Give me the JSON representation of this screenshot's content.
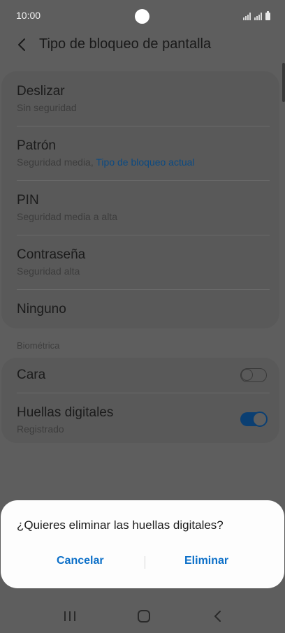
{
  "status_bar": {
    "time": "10:00"
  },
  "header": {
    "title": "Tipo de bloqueo de pantalla",
    "back_icon": "chevron-left-icon"
  },
  "lock_types": [
    {
      "title": "Deslizar",
      "subtitle": "Sin seguridad"
    },
    {
      "title": "Patrón",
      "subtitle": "Seguridad media,",
      "subtitle_accent": "Tipo de bloqueo actual"
    },
    {
      "title": "PIN",
      "subtitle": "Seguridad media a alta"
    },
    {
      "title": "Contraseña",
      "subtitle": "Seguridad alta"
    },
    {
      "title": "Ninguno"
    }
  ],
  "biometrics": {
    "section_label": "Biométrica",
    "items": [
      {
        "title": "Cara",
        "toggle_on": false
      },
      {
        "title": "Huellas digitales",
        "subtitle": "Registrado",
        "toggle_on": true
      }
    ]
  },
  "dialog": {
    "message": "¿Quieres eliminar las huellas digitales?",
    "cancel_label": "Cancelar",
    "confirm_label": "Eliminar"
  },
  "nav_bar": {
    "recent_icon": "recent-apps-icon",
    "home_icon": "home-icon",
    "back_icon": "back-icon"
  },
  "colors": {
    "accent": "#0b6fc8",
    "toggle_on": "#0b3f72",
    "dim_overlay": "#5e5e5e"
  }
}
